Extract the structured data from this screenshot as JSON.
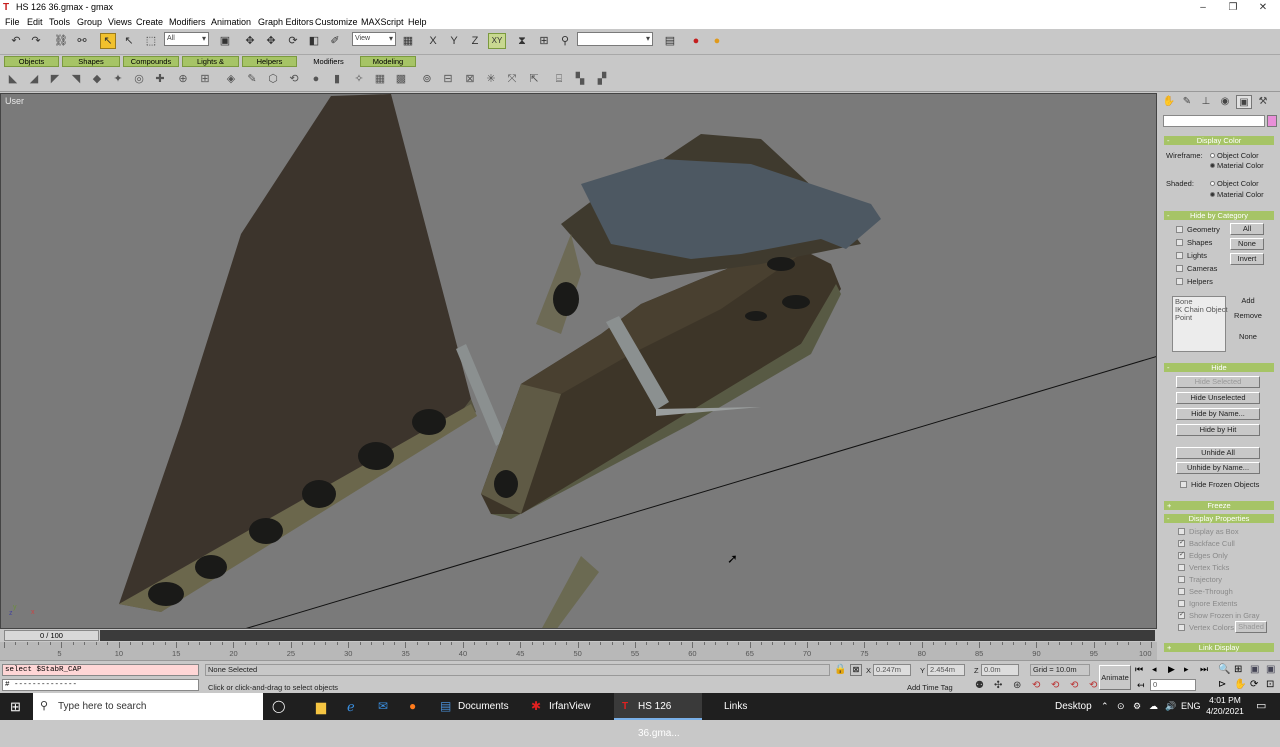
{
  "window": {
    "title": "HS 126 36.gmax - gmax",
    "minimize": "–",
    "restore": "❐",
    "close": "✕"
  },
  "menu": [
    "File",
    "Edit",
    "Tools",
    "Group",
    "Views",
    "Create",
    "Modifiers",
    "Animation",
    "Graph Editors",
    "Customize",
    "MAXScript",
    "Help"
  ],
  "toolbar": {
    "filter_select": "All",
    "view_select": "View",
    "named_sel": "",
    "xy_label": "XY"
  },
  "tabs": [
    "Objects",
    "Shapes",
    "Compounds",
    "Lights & Cameras",
    "Helpers",
    "Modifiers",
    "Modeling"
  ],
  "active_tab": "Modifiers",
  "viewport": {
    "label": "User",
    "cursor": "➚",
    "axis_x": "x",
    "axis_y": "y",
    "axis_z": "z"
  },
  "panel": {
    "display_color": {
      "title": "Display Color",
      "wireframe_label": "Wireframe:",
      "shaded_label": "Shaded:",
      "object_color": "Object Color",
      "material_color": "Material Color"
    },
    "hide_by_category": {
      "title": "Hide by Category",
      "items": [
        "Geometry",
        "Shapes",
        "Lights",
        "Cameras",
        "Helpers"
      ],
      "btn_all": "All",
      "btn_none": "None",
      "btn_invert": "Invert",
      "list": [
        "Bone",
        "IK Chain Object",
        "Point"
      ],
      "btn_add": "Add",
      "btn_remove": "Remove",
      "btn_none2": "None"
    },
    "hide": {
      "title": "Hide",
      "hide_selected": "Hide Selected",
      "hide_unselected": "Hide Unselected",
      "hide_by_name": "Hide by Name...",
      "hide_by_hit": "Hide by Hit",
      "unhide_all": "Unhide All",
      "unhide_by_name": "Unhide by Name...",
      "hide_frozen": "Hide Frozen Objects"
    },
    "freeze": {
      "title": "Freeze"
    },
    "display_properties": {
      "title": "Display Properties",
      "items": [
        "Display as Box",
        "Backface Cull",
        "Edges Only",
        "Vertex Ticks",
        "Trajectory",
        "See-Through",
        "Ignore Extents",
        "Show Frozen in Gray",
        "Vertex Colors"
      ],
      "shaded_btn": "Shaded"
    },
    "link_display": {
      "title": "Link Display"
    }
  },
  "timeline": {
    "frame": "0 / 100",
    "ticks": [
      "0",
      "5",
      "10",
      "15",
      "20",
      "25",
      "30",
      "35",
      "40",
      "45",
      "50",
      "55",
      "60",
      "65",
      "70",
      "75",
      "80",
      "85",
      "90",
      "95",
      "100"
    ]
  },
  "status": {
    "script_line1": "select $StabR_CAP",
    "script_line2": "# --------------",
    "selection": "None Selected",
    "prompt": "Click or click-and-drag to select objects",
    "x_label": "X",
    "x_val": "0.247m",
    "y_label": "Y",
    "y_val": "2.454m",
    "z_label": "Z",
    "z_val": "0.0m",
    "grid": "Grid = 10.0m",
    "add_time_tag": "Add Time Tag",
    "animate": "Animate",
    "frame_field": "0"
  },
  "taskbar": {
    "search": "Type here to search",
    "apps": [
      "Documents",
      "IrfanView",
      "HS 126 36.gma...",
      "Links"
    ],
    "desktop": "Desktop",
    "lang": "ENG",
    "time": "4:01 PM",
    "date": "4/20/2021"
  }
}
